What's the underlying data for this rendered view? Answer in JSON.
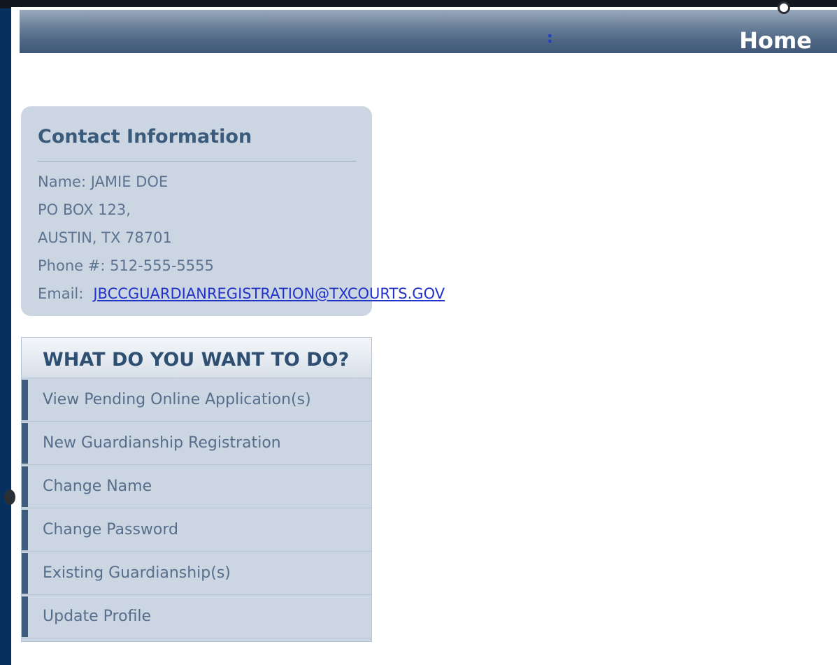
{
  "header": {
    "colon": ":",
    "title": "Home"
  },
  "contact": {
    "title": "Contact Information",
    "name": "Name: JAMIE DOE",
    "address_line1": "PO BOX 123,",
    "address_line2": "AUSTIN, TX  78701",
    "phone": "Phone #: 512-555-5555",
    "email_label": "Email:",
    "email_value": "JBCCGUARDIANREGISTRATION@TXCOURTS.GOV"
  },
  "menu": {
    "title": "WHAT DO YOU WANT TO DO?",
    "items": [
      {
        "label": "View Pending Online Application(s)"
      },
      {
        "label": "New Guardianship Registration"
      },
      {
        "label": "Change Name"
      },
      {
        "label": "Change Password"
      },
      {
        "label": "Existing Guardianship(s)"
      },
      {
        "label": "Update Profile"
      }
    ]
  },
  "colors": {
    "frame_bg": "#06305e",
    "header_gradient_top": "#9aaabd",
    "header_gradient_bottom": "#3f5878",
    "panel_bg": "#ccd6e2",
    "accent": "#3d5d80",
    "link": "#2233cc"
  }
}
